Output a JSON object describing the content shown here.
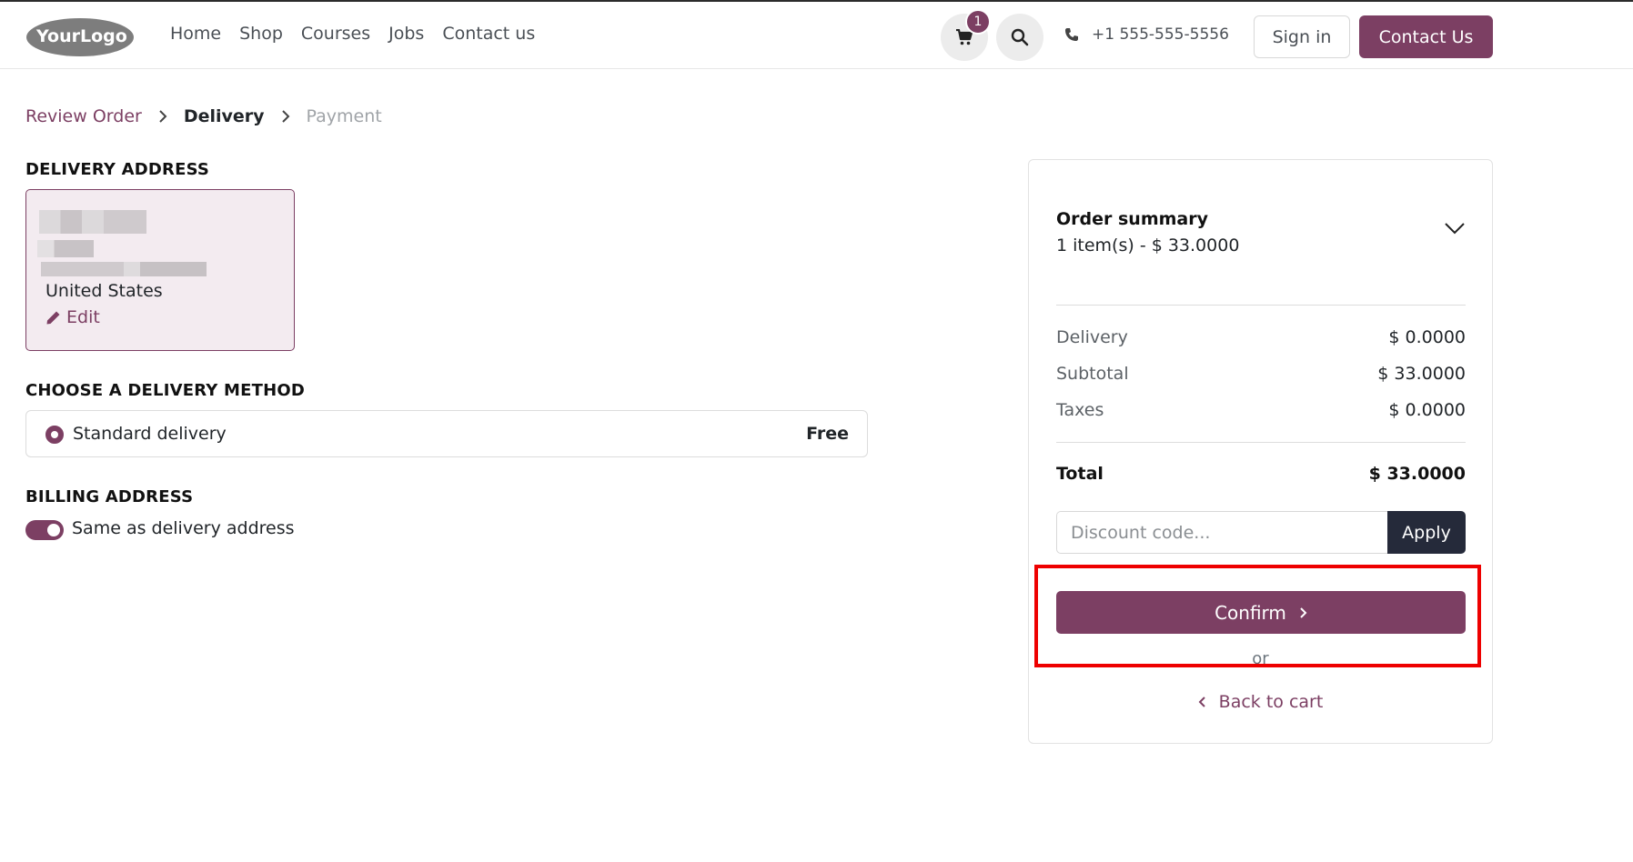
{
  "header": {
    "logo_text": "YourLogo",
    "nav": [
      "Home",
      "Shop",
      "Courses",
      "Jobs",
      "Contact us"
    ],
    "cart_count": "1",
    "phone": "+1 555-555-5556",
    "sign_in": "Sign in",
    "contact_button": "Contact Us"
  },
  "breadcrumb": {
    "review": "Review Order",
    "delivery": "Delivery",
    "payment": "Payment"
  },
  "delivery_address": {
    "title": "DELIVERY ADDRESS",
    "country": "United States",
    "edit": "Edit"
  },
  "delivery_method": {
    "title": "CHOOSE A DELIVERY METHOD",
    "option_label": "Standard delivery",
    "option_price": "Free"
  },
  "billing": {
    "title": "BILLING ADDRESS",
    "same_label": "Same as delivery address",
    "same_checked": true
  },
  "summary": {
    "title": "Order summary",
    "items": "1 item(s) -  $ 33.0000",
    "delivery_label": "Delivery",
    "delivery_value": "$ 0.0000",
    "subtotal_label": "Subtotal",
    "subtotal_value": "$ 33.0000",
    "taxes_label": "Taxes",
    "taxes_value": "$ 0.0000",
    "total_label": "Total",
    "total_value": "$ 33.0000",
    "discount_placeholder": "Discount code...",
    "apply": "Apply",
    "confirm": "Confirm",
    "or": "or",
    "back": "Back to cart"
  },
  "colors": {
    "accent": "#7c3f63",
    "dark_button": "#252a3a",
    "highlight": "#ee0000"
  }
}
